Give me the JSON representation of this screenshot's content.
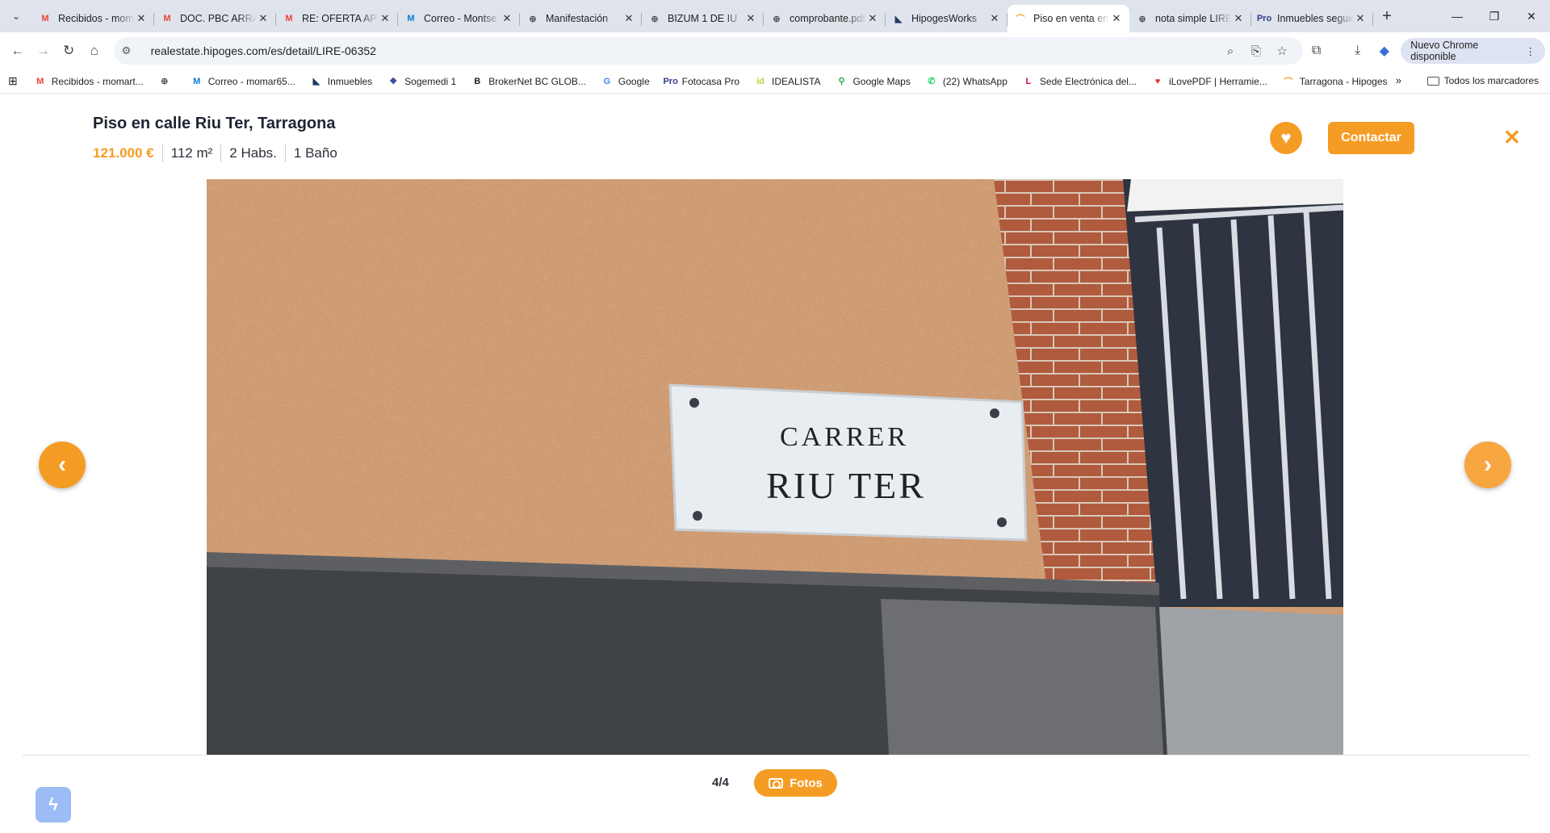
{
  "browser": {
    "tabs": [
      {
        "title": "Recibidos - momart",
        "icon": "gmail-icon",
        "color": "#ea4335",
        "glyph": "M"
      },
      {
        "title": "DOC. PBC ARRAS",
        "icon": "gmail-icon",
        "color": "#ea4335",
        "glyph": "M"
      },
      {
        "title": "RE: OFERTA APTO",
        "icon": "gmail-icon",
        "color": "#ea4335",
        "glyph": "M"
      },
      {
        "title": "Correo - Montse",
        "icon": "movistar-icon",
        "color": "#0b7ad1",
        "glyph": "M"
      },
      {
        "title": "Manifestación",
        "icon": "globe-icon",
        "color": "#555555",
        "glyph": "⊕"
      },
      {
        "title": "BIZUM 1 DE IU",
        "icon": "globe-icon",
        "color": "#555555",
        "glyph": "⊕"
      },
      {
        "title": "comprobante.pdf",
        "icon": "globe-icon",
        "color": "#555555",
        "glyph": "⊕"
      },
      {
        "title": "HipogesWorks",
        "icon": "hipoges-icon",
        "color": "#1f3a5f",
        "glyph": "◣"
      },
      {
        "title": "Piso en venta en",
        "icon": "hipoges-realestate-icon",
        "color": "#f59c24",
        "glyph": "⌒",
        "active": true
      },
      {
        "title": "nota simple LIRE",
        "icon": "globe-icon",
        "color": "#555555",
        "glyph": "⊕"
      },
      {
        "title": "Inmuebles seguidos",
        "icon": "fotocasa-pro-icon",
        "color": "#2e3a8c",
        "glyph": "Pro"
      }
    ],
    "url": "realestate.hipoges.com/es/detail/LIRE-06352",
    "update_label": "Nuevo Chrome disponible",
    "bookmarks": [
      {
        "label": "Recibidos - momart...",
        "icon": "gmail-icon",
        "color": "#ea4335",
        "glyph": "M"
      },
      {
        "label": "",
        "icon": "globe-icon",
        "color": "#555555",
        "glyph": "⊕"
      },
      {
        "label": "Correo - momar65...",
        "icon": "movistar-icon",
        "color": "#0b7ad1",
        "glyph": "M"
      },
      {
        "label": "Inmuebles",
        "icon": "hipoges-icon",
        "color": "#1f3a5f",
        "glyph": "◣"
      },
      {
        "label": "Sogemedi 1",
        "icon": "sogemedi-icon",
        "color": "#3b4a9a",
        "glyph": "❖"
      },
      {
        "label": "BrokerNet BC GLOB...",
        "icon": "brokernet-icon",
        "color": "#222222",
        "glyph": "B"
      },
      {
        "label": "Google",
        "icon": "google-icon",
        "color": "#4285f4",
        "glyph": "G"
      },
      {
        "label": "Fotocasa Pro",
        "icon": "fotocasa-pro-icon",
        "color": "#2e3a8c",
        "glyph": "Pro"
      },
      {
        "label": "IDEALISTA",
        "icon": "idealista-icon",
        "color": "#b7d334",
        "glyph": "id"
      },
      {
        "label": "Google Maps",
        "icon": "maps-pin-icon",
        "color": "#34a853",
        "glyph": "⚲"
      },
      {
        "label": "(22) WhatsApp",
        "icon": "whatsapp-icon",
        "color": "#25d366",
        "glyph": "✆"
      },
      {
        "label": "Sede Electrónica del...",
        "icon": "sede-icon",
        "color": "#c8102e",
        "glyph": "L"
      },
      {
        "label": "iLovePDF | Herramie...",
        "icon": "ilovepdf-icon",
        "color": "#e5322d",
        "glyph": "♥"
      },
      {
        "label": "Tarragona - Hipoges",
        "icon": "hipoges-realestate-icon",
        "color": "#f59c24",
        "glyph": "⌒"
      }
    ],
    "all_bookmarks_label": "Todos los marcadores"
  },
  "listing": {
    "title": "Piso en calle Riu Ter, Tarragona",
    "price": "121.000 €",
    "area": "112 m²",
    "rooms": "2 Habs.",
    "baths": "1 Baño",
    "contact_label": "Contactar",
    "photo": {
      "sign_line1": "CARRER",
      "sign_line2": "RIU TER"
    },
    "counter": "4/4",
    "photos_label": "Fotos"
  },
  "colors": {
    "accent": "#f59c24",
    "tabstrip": "#dfe3eb"
  }
}
